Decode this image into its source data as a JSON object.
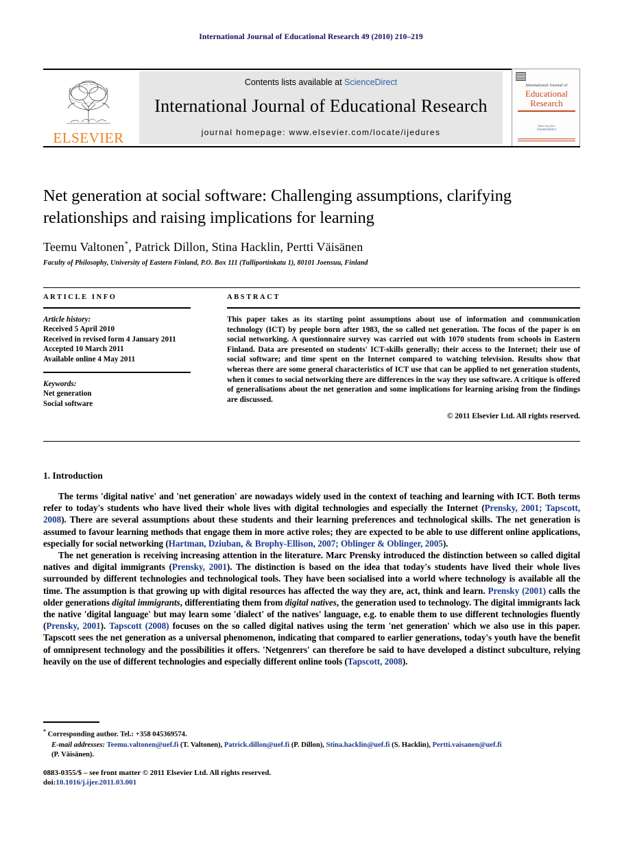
{
  "running_head": "International Journal of Educational Research 49 (2010) 210–219",
  "masthead": {
    "publisher_name": "ELSEVIER",
    "contents_prefix": "Contents lists available at ",
    "contents_link": "ScienceDirect",
    "journal_name": "International Journal of Educational Research",
    "homepage": "journal homepage: www.elsevier.com/locate/ijedures",
    "cover": {
      "top_line": "International Journal of",
      "title_line1": "Educational",
      "title_line2": "Research",
      "mid_line": "Editor-in-Chief",
      "sd_text": "ScienceDirect"
    }
  },
  "article": {
    "title": "Net generation at social software: Challenging assumptions, clarifying relationships and raising implications for learning",
    "authors": "Teemu Valtonen",
    "authors_rest": ", Patrick Dillon, Stina Hacklin, Pertti Väisänen",
    "affiliation": "Faculty of Philosophy, University of Eastern Finland, P.O. Box 111 (Tulliportinkatu 1), 80101 Joensuu, Finland"
  },
  "info": {
    "label": "ARTICLE INFO",
    "history_head": "Article history:",
    "history": [
      "Received 5 April 2010",
      "Received in revised form 4 January 2011",
      "Accepted 10 March 2011",
      "Available online 4 May 2011"
    ],
    "keywords_head": "Keywords:",
    "keywords": [
      "Net generation",
      "Social software"
    ]
  },
  "abstract": {
    "label": "ABSTRACT",
    "text": "This paper takes as its starting point assumptions about use of information and communication technology (ICT) by people born after 1983, the so called net generation. The focus of the paper is on social networking. A questionnaire survey was carried out with 1070 students from schools in Eastern Finland. Data are presented on students' ICT-skills generally; their access to the Internet; their use of social software; and time spent on the Internet compared to watching television. Results show that whereas there are some general characteristics of ICT use that can be applied to net generation students, when it comes to social networking there are differences in the way they use software. A critique is offered of generalisations about the net generation and some implications for learning arising from the findings are discussed.",
    "copyright": "© 2011 Elsevier Ltd. All rights reserved."
  },
  "sections": {
    "intro_heading": "1. Introduction",
    "para1": {
      "t1": "The terms 'digital native' and 'net generation' are nowadays widely used in the context of teaching and learning with ICT. Both terms refer to today's students who have lived their whole lives with digital technologies and especially the Internet (",
      "c1": "Prensky, 2001; Tapscott, 2008",
      "t2": "). There are several assumptions about these students and their learning preferences and technological skills. The net generation is assumed to favour learning methods that engage them in more active roles; they are expected to be able to use different online applications, especially for social networking (",
      "c2": "Hartman, Dziuban, & Brophy-Ellison, 2007; Oblinger & Oblinger, 2005",
      "t3": ")."
    },
    "para2": {
      "t1": "The net generation is receiving increasing attention in the literature. Marc Prensky introduced the distinction between so called digital natives and digital immigrants (",
      "c1": "Prensky, 2001",
      "t2": "). The distinction is based on the idea that today's students have lived their whole lives surrounded by different technologies and technological tools. They have been socialised into a world where technology is available all the time. The assumption is that growing up with digital resources has affected the way they are, act, think and learn. ",
      "c2": "Prensky (2001)",
      "t3": " calls the older generations ",
      "i1": "digital immigrants",
      "t4": ", differentiating them from ",
      "i2": "digital natives",
      "t5": ", the generation used to technology. The digital immigrants lack the native 'digital language' but may learn some 'dialect' of the natives' language, e.g. to enable them to use different technologies fluently (",
      "c3": "Prensky, 2001",
      "t6": "). ",
      "c4": "Tapscott (2008)",
      "t7": " focuses on the so called digital natives using the term 'net generation' which we also use in this paper. Tapscott sees the net generation as a universal phenomenon, indicating that compared to earlier generations, today's youth have the benefit of omnipresent technology and the possibilities it offers. 'Netgenrers' can therefore be said to have developed a distinct subculture, relying heavily on the use of different technologies and especially different online tools (",
      "c5": "Tapscott, 2008",
      "t8": ")."
    }
  },
  "footnotes": {
    "corresponding": "Corresponding author. Tel.: +358 045369574.",
    "email_label": "E-mail addresses:",
    "emails": [
      {
        "address": "Teemu.valtonen@uef.fi",
        "name": " (T. Valtonen), "
      },
      {
        "address": "Patrick.dillon@uef.fi",
        "name": " (P. Dillon), "
      },
      {
        "address": "Stina.hacklin@uef.fi",
        "name": " (S. Hacklin), "
      },
      {
        "address": "Pertti.vaisanen@uef.fi",
        "name": ""
      }
    ],
    "email_tail": "(P. Väisänen)."
  },
  "footer": {
    "issn_line": "0883-0355/$ – see front matter © 2011 Elsevier Ltd. All rights reserved.",
    "doi_label": "doi:",
    "doi_value": "10.1016/j.ijer.2011.03.001"
  }
}
